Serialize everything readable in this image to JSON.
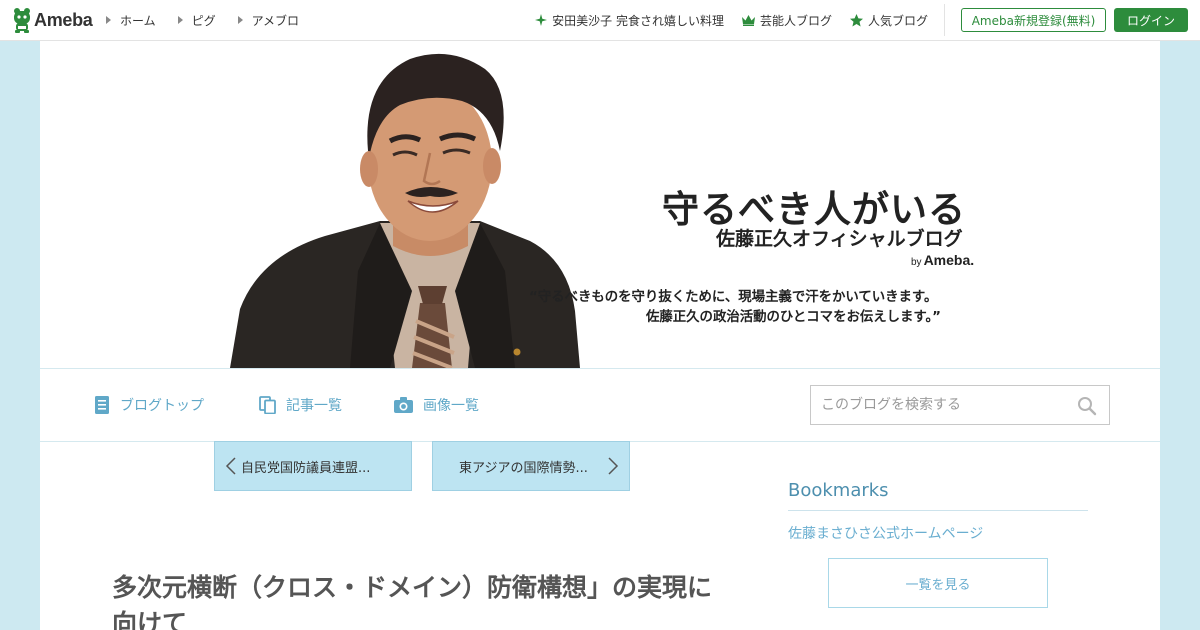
{
  "topbar": {
    "logo_text": "Ameba",
    "nav": [
      {
        "label": "ホーム"
      },
      {
        "label": "ピグ"
      },
      {
        "label": "アメブロ"
      }
    ],
    "right_links": [
      {
        "label": "安田美沙子 完食され嬉しい料理",
        "icon": "sparkle-icon"
      },
      {
        "label": "芸能人ブログ",
        "icon": "crown-icon"
      },
      {
        "label": "人気ブログ",
        "icon": "star-icon"
      }
    ],
    "register_label": "Ameba新規登録(無料)",
    "login_label": "ログイン",
    "accent_color": "#2d8c3c"
  },
  "banner": {
    "title": "守るべき人がいる",
    "subtitle": "佐藤正久オフィシャルブログ",
    "by_prefix": "by",
    "by_brand": "Ameba.",
    "quote_line1": "“守るべきものを守り抜くために、現場主義で汗をかいていきます。",
    "quote_line2": "佐藤正久の政治活動のひとコマをお伝えします。”"
  },
  "blognav": {
    "items": [
      {
        "label": "ブログトップ",
        "icon": "document-icon"
      },
      {
        "label": "記事一覧",
        "icon": "copy-icon"
      },
      {
        "label": "画像一覧",
        "icon": "camera-icon"
      }
    ],
    "search_placeholder": "このブログを検索する",
    "link_color": "#60a8c8"
  },
  "content": {
    "prev_label": "自民党国防議員連盟...",
    "next_label": "東アジアの国際情勢...",
    "article_title": "多次元横断（クロス・ドメイン）防衛構想」の実現に向けて"
  },
  "sidebar": {
    "heading": "Bookmarks",
    "link": "佐藤まさひさ公式ホームページ",
    "more_label": "一覧を見る"
  }
}
